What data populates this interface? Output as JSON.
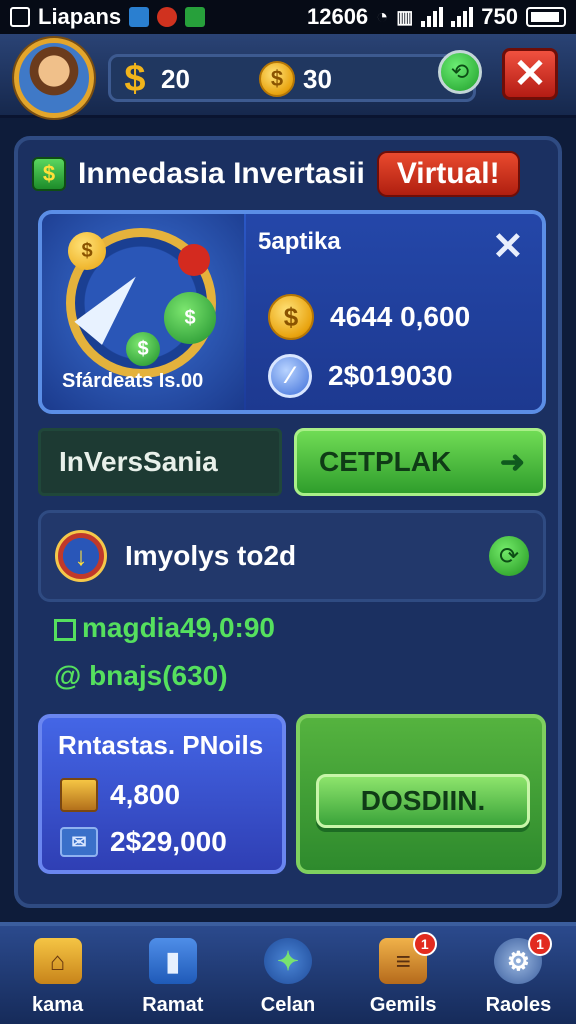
{
  "status_bar": {
    "carrier": "Liapans",
    "time": "12606",
    "battery": "750"
  },
  "header": {
    "coins_1": "20",
    "coins_2": "30",
    "close_label": "✕"
  },
  "panel": {
    "title": "Inmedasia Invertasii",
    "badge": "Virtual!",
    "card": {
      "label": "Sfárdeats Is.00",
      "name": "5aptika",
      "value_1": "4644 0,600",
      "value_2": "2$019030"
    },
    "invest_label": "InVersSania",
    "action_button": "CETPLAK",
    "info_text": "Imyolys to2d",
    "green_line_1": "magdia49,0:90",
    "green_line_2": "@ bnajs(630)",
    "rental": {
      "title": "Rntastas. PNoils",
      "value_1": "4,800",
      "value_2": "2$29,000"
    },
    "dosdin_button": "DOSDIIN."
  },
  "bottom_nav": [
    {
      "label": "kama",
      "icon": "home-icon",
      "badge": ""
    },
    {
      "label": "Ramat",
      "icon": "book-icon",
      "badge": ""
    },
    {
      "label": "Celan",
      "icon": "globe-icon",
      "badge": ""
    },
    {
      "label": "Gemils",
      "icon": "ticket-icon",
      "badge": "1"
    },
    {
      "label": "Raoles",
      "icon": "gear-icon",
      "badge": "1"
    }
  ],
  "colors": {
    "accent_gold": "#e3a52b",
    "accent_green": "#55e05e",
    "accent_red": "#e22b1f",
    "background": "#0e1c3a"
  }
}
